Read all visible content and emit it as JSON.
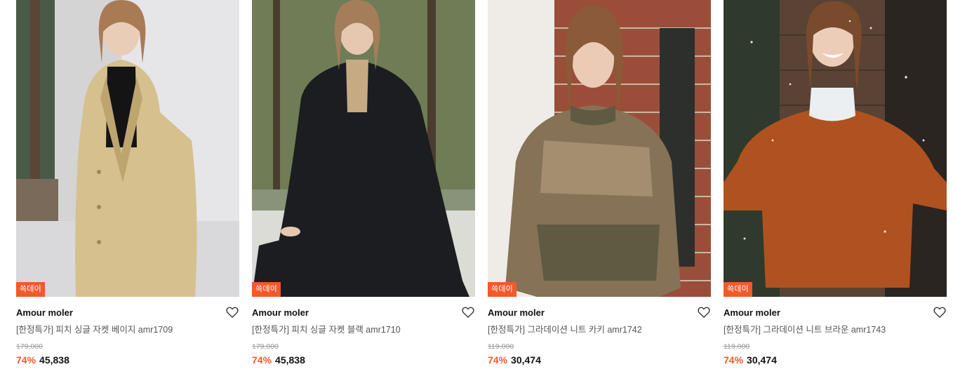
{
  "products": [
    {
      "badge": "쓱데이",
      "brand": "Amour moler",
      "title": "[한정특가] 피치 싱글 자켓 베이지 amr1709",
      "original_price": "179,000",
      "discount": "74%",
      "price": "45,838",
      "image": "model in beige oversized jacket and black turtleneck"
    },
    {
      "badge": "쓱데이",
      "brand": "Amour moler",
      "title": "[한정특가] 피치 싱글 자켓 블랙 amr1710",
      "original_price": "179,000",
      "discount": "74%",
      "price": "45,838",
      "image": "model in black jacket over beige turtleneck, forest background"
    },
    {
      "badge": "쓱데이",
      "brand": "Amour moler",
      "title": "[한정특가] 그라데이션 니트 카키 amr1742",
      "original_price": "119,000",
      "discount": "74%",
      "price": "30,474",
      "image": "model in khaki gradient knit sweater, brick wall background"
    },
    {
      "badge": "쓱데이",
      "brand": "Amour moler",
      "title": "[한정특가] 그라데이션 니트 브라운 amr1743",
      "original_price": "119,000",
      "discount": "74%",
      "price": "30,474",
      "image": "model in brown fuzzy knit sweater and white turtleneck, snowy wooden background"
    }
  ],
  "colors": {
    "badge": "#f25a29",
    "discount": "#f25a29"
  },
  "icons": {
    "wishlist": "heart-outline-icon"
  }
}
